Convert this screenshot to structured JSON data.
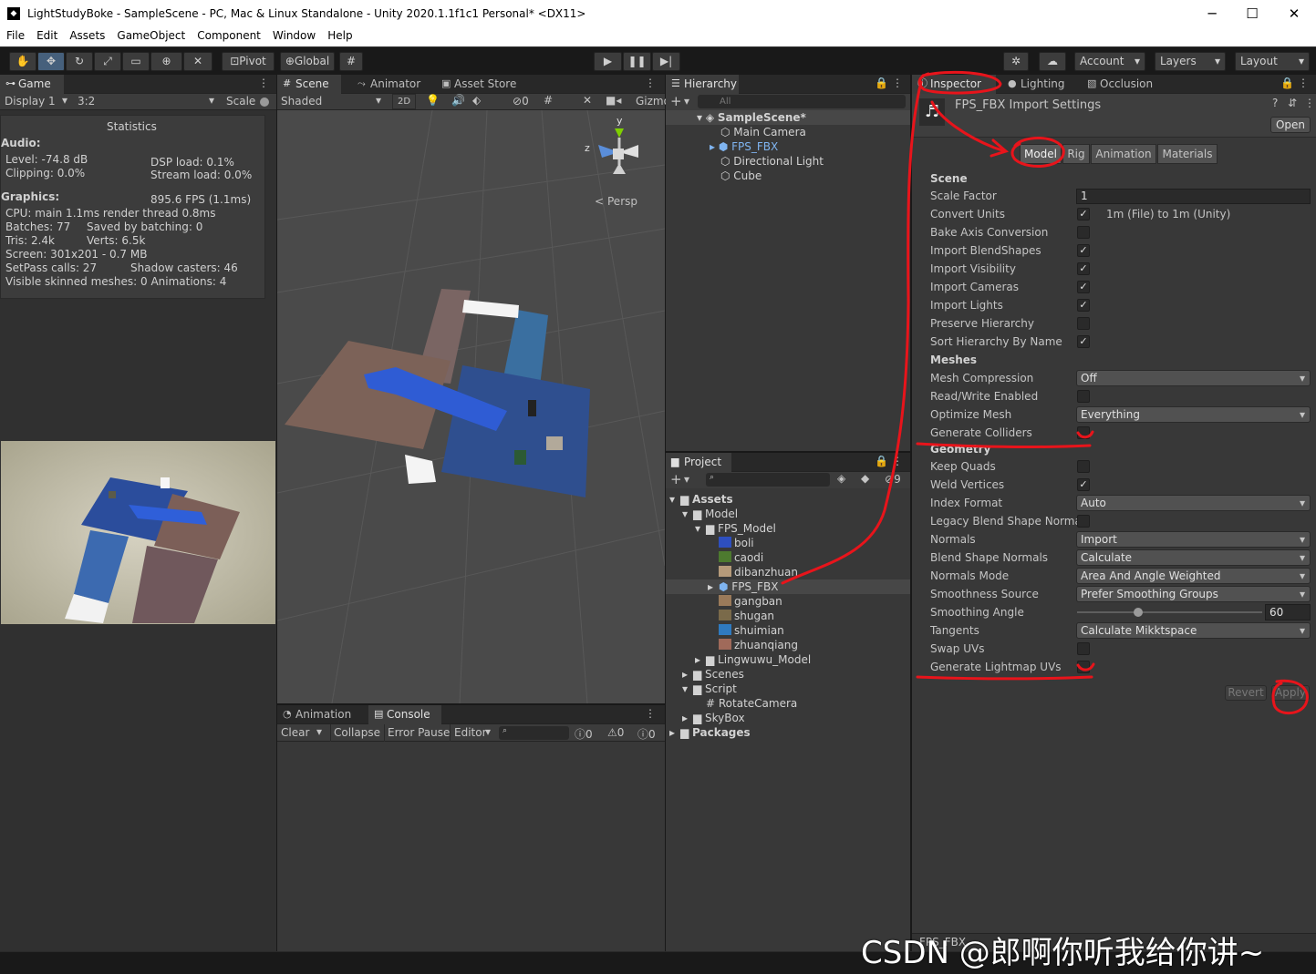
{
  "window": {
    "title": "LightStudyBoke - SampleScene - PC, Mac & Linux Standalone - Unity 2020.1.1f1c1 Personal* <DX11>",
    "min": "─",
    "max": "☐",
    "close": "✕"
  },
  "menu": [
    "File",
    "Edit",
    "Assets",
    "GameObject",
    "Component",
    "Window",
    "Help"
  ],
  "toolbar": {
    "pivot": "Pivot",
    "global": "Global",
    "account": "Account",
    "layers": "Layers",
    "layout": "Layout"
  },
  "game": {
    "tab": "Game",
    "display": "Display 1",
    "aspect": "3:2",
    "scale_label": "Scale",
    "stats_title": "Statistics",
    "audio_label": "Audio:",
    "level": "Level: -74.8 dB",
    "clipping": "Clipping: 0.0%",
    "dsp": "DSP load: 0.1%",
    "stream": "Stream load: 0.0%",
    "graphics_label": "Graphics:",
    "fps": "895.6 FPS (1.1ms)",
    "cpu": "CPU: main 1.1ms  render thread 0.8ms",
    "batches": "Batches: 77",
    "saved": "Saved by batching: 0",
    "tris": "Tris: 2.4k",
    "verts": "Verts: 6.5k",
    "screen": "Screen: 301x201 - 0.7 MB",
    "setpass": "SetPass calls: 27",
    "shadow": "Shadow casters: 46",
    "skinned": "Visible skinned meshes: 0  Animations: 4"
  },
  "scene": {
    "tabs": [
      "Scene",
      "Animator",
      "Asset Store"
    ],
    "shaded": "Shaded",
    "twod": "2D",
    "fx_count": "0",
    "gizmos": "Gizmo",
    "persp": "Persp",
    "axis_y": "y",
    "axis_z": "z"
  },
  "console": {
    "tabs": [
      "Animation",
      "Console"
    ],
    "clear": "Clear",
    "collapse": "Collapse",
    "error_pause": "Error Pause",
    "editor": "Editor",
    "info": "0",
    "warn": "0",
    "err": "0"
  },
  "hierarchy": {
    "tab": "Hierarchy",
    "search": "All",
    "scene": "SampleScene*",
    "items": [
      "Main Camera",
      "FPS_FBX",
      "Directional Light",
      "Cube"
    ]
  },
  "project": {
    "tab": "Project",
    "hidden_count": "9",
    "items": [
      "Assets",
      "Model",
      "FPS_Model",
      "boli",
      "caodi",
      "dibanzhuan",
      "FPS_FBX",
      "gangban",
      "shugan",
      "shuimian",
      "zhuanqiang",
      "Lingwuwu_Model",
      "Scenes",
      "Script",
      "RotateCamera",
      "SkyBox",
      "Packages"
    ]
  },
  "inspector": {
    "tabs": [
      "Inspector",
      "Lighting",
      "Occlusion"
    ],
    "header": "FPS_FBX Import Settings",
    "open": "Open",
    "import_tabs": [
      "Model",
      "Rig",
      "Animation",
      "Materials"
    ],
    "scene_section": "Scene",
    "meshes_section": "Meshes",
    "geometry_section": "Geometry",
    "scale_factor_label": "Scale Factor",
    "scale_factor": "1",
    "convert_units_label": "Convert Units",
    "convert_units_note": "1m (File) to 1m (Unity)",
    "bake_axis": "Bake Axis Conversion",
    "blendshapes": "Import BlendShapes",
    "visibility": "Import Visibility",
    "cameras": "Import Cameras",
    "lights": "Import Lights",
    "preserve": "Preserve Hierarchy",
    "sort_by_name": "Sort Hierarchy By Name",
    "mesh_compression_label": "Mesh Compression",
    "mesh_compression": "Off",
    "rw_enabled": "Read/Write Enabled",
    "optimize_mesh_label": "Optimize Mesh",
    "optimize_mesh": "Everything",
    "gen_colliders": "Generate Colliders",
    "keep_quads": "Keep Quads",
    "weld_vertices": "Weld Vertices",
    "index_format_label": "Index Format",
    "index_format": "Auto",
    "legacy_blend": "Legacy Blend Shape Normal",
    "normals_label": "Normals",
    "normals": "Import",
    "blend_normals_label": "Blend Shape Normals",
    "blend_normals": "Calculate",
    "normals_mode_label": "Normals Mode",
    "normals_mode": "Area And Angle Weighted",
    "smooth_source_label": "Smoothness Source",
    "smooth_source": "Prefer Smoothing Groups",
    "smooth_angle_label": "Smoothing Angle",
    "smooth_angle": "60",
    "smooth_angle_fraction": 0.33,
    "tangents_label": "Tangents",
    "tangents": "Calculate Mikktspace",
    "swap_uvs": "Swap UVs",
    "gen_lightmap_uvs": "Generate Lightmap UVs",
    "revert": "Revert",
    "apply": "Apply",
    "bottom_asset": "FPS_FBX"
  },
  "watermark": "CSDN @郎啊你听我给你讲~",
  "colors": {
    "annotation": "#e8141b",
    "accent": "#46607c"
  }
}
